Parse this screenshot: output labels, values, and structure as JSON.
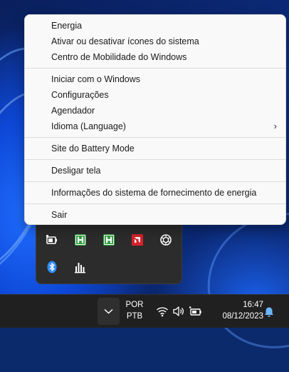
{
  "menu": {
    "items": [
      {
        "label": "Energia"
      },
      {
        "label": "Ativar ou desativar ícones do sistema"
      },
      {
        "label": "Centro de Mobilidade do Windows"
      },
      {
        "label": "Iniciar com o Windows"
      },
      {
        "label": "Configurações"
      },
      {
        "label": "Agendador"
      },
      {
        "label": "Idioma (Language)",
        "submenu_glyph": "›"
      },
      {
        "label": "Site do Battery Mode"
      },
      {
        "label": "Desligar tela"
      },
      {
        "label": "Informações do sistema de fornecimento de energia"
      },
      {
        "label": "Sair"
      }
    ]
  },
  "tray_flyout": {
    "icons": [
      "battery-mode-icon",
      "hwinfo-icon",
      "hwinfo-icon",
      "amd-icon",
      "openai-icon",
      "bluetooth-icon",
      "audio-meter-icon"
    ]
  },
  "taskbar": {
    "language_line1": "POR",
    "language_line2": "PTB",
    "time": "16:47",
    "date": "08/12/2023",
    "icons": [
      "chevron-up-icon",
      "wifi-icon",
      "volume-icon",
      "battery-icon",
      "notification-bell-icon"
    ]
  },
  "colors": {
    "accent": "#2f8cff",
    "hwinfo_green": "#2e9e3e",
    "amd_red": "#d6222b",
    "bell_blue": "#6cb8ff"
  }
}
